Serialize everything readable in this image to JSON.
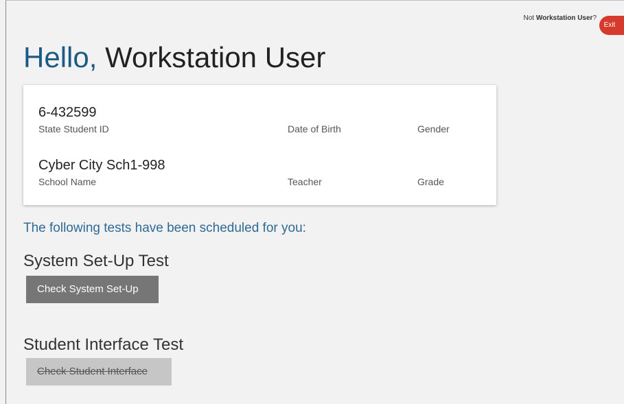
{
  "header": {
    "not_prefix": "Not ",
    "user_name": "Workstation User",
    "not_suffix": "?",
    "exit_label": "Exit"
  },
  "greeting": {
    "hello": "Hello,",
    "name": "Workstation User"
  },
  "student_card": {
    "student_id": "6-432599",
    "student_id_label": "State Student ID",
    "dob_label": "Date of Birth",
    "gender_label": "Gender",
    "school_name": "Cyber City Sch1-998",
    "school_name_label": "School Name",
    "teacher_label": "Teacher",
    "grade_label": "Grade"
  },
  "scheduled_heading": "The following tests have been scheduled for you:",
  "tests": [
    {
      "title": "System Set-Up Test",
      "button_label": "Check System Set-Up",
      "enabled": true
    },
    {
      "title": "Student Interface Test",
      "button_label": "Check Student Interface",
      "enabled": false
    }
  ],
  "colors": {
    "hello_blue": "#1c5a86",
    "heading_blue": "#2e6a96",
    "exit_red": "#d63a2c",
    "button_gray": "#767676",
    "disabled_gray": "#c6c6c6"
  }
}
